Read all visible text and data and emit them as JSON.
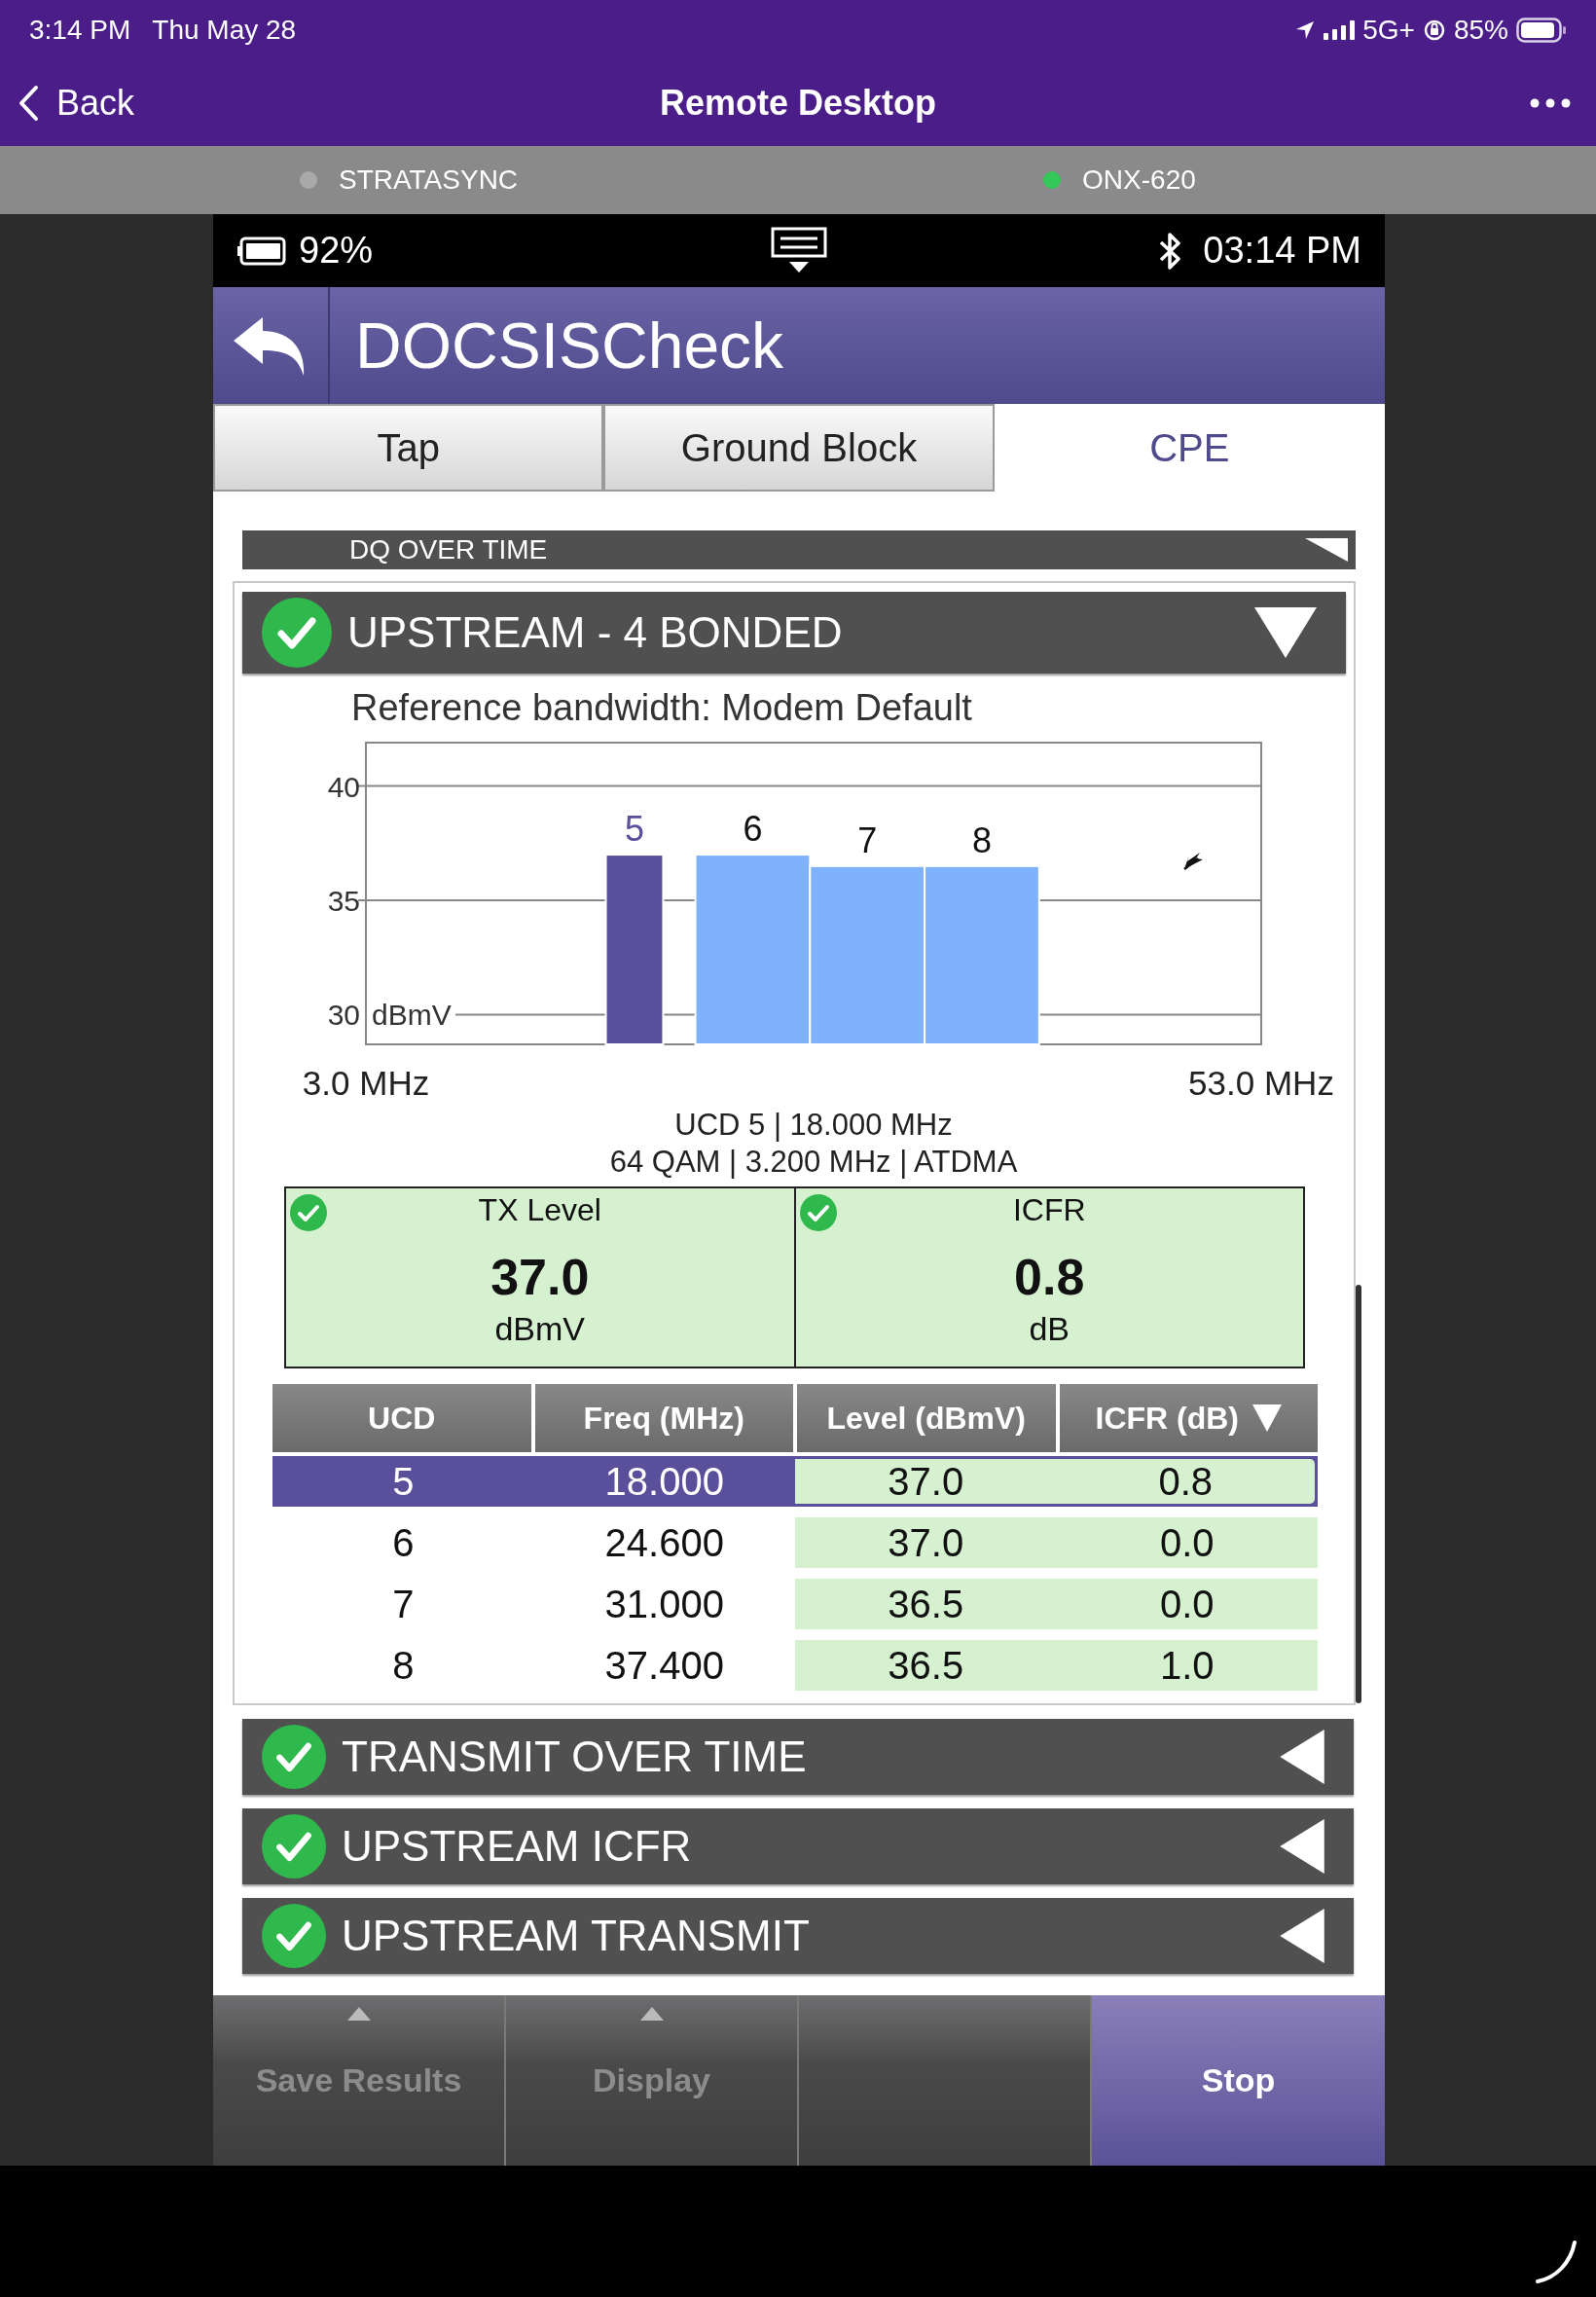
{
  "ios_status_bar": {
    "time": "3:14 PM",
    "date": "Thu May 28",
    "network": "5G+",
    "battery": "85%"
  },
  "nav_bar": {
    "back": "Back",
    "title": "Remote Desktop"
  },
  "connections": [
    {
      "name": "STRATASYNC",
      "color": "#a9a9a9"
    },
    {
      "name": "ONX-620",
      "color": "#34c759"
    }
  ],
  "device": {
    "status_bar": {
      "battery": "92%",
      "time": "03:14 PM"
    },
    "title": "DOCSISCheck",
    "tabs": [
      {
        "label": "Tap",
        "selected": false
      },
      {
        "label": "Ground Block",
        "selected": false
      },
      {
        "label": "CPE",
        "selected": true
      }
    ],
    "partial_section": {
      "title": "DQ OVER TIME"
    },
    "upstream": {
      "title": "UPSTREAM - 4 BONDED",
      "passed": true,
      "expanded": true,
      "reference": "Reference bandwidth: Modem Default",
      "chart_data": {
        "type": "bar",
        "x": [
          18.0,
          24.6,
          31.0,
          37.4
        ],
        "ylabel": "dBmV",
        "xlim": [
          3,
          53
        ],
        "ylim": [
          28.7,
          41.9
        ],
        "yticks": [
          30,
          35,
          40
        ],
        "xticks": [
          {
            "value": 3,
            "label": "3.0 MHz"
          },
          {
            "value": 53,
            "label": "53.0 MHz"
          }
        ],
        "grid": true,
        "value_labels": [
          "5",
          "6",
          "7",
          "8"
        ],
        "series": [
          {
            "color": "#5a4f9a",
            "values": [
              37.0,
              null,
              null,
              null
            ]
          },
          {
            "color": "#80b2fb",
            "values": [
              null,
              37.0,
              36.5,
              36.5
            ]
          }
        ]
      },
      "channel_info": [
        "UCD 5 | 18.000 MHz",
        "64 QAM | 3.200 MHz | ATDMA"
      ],
      "metrics": [
        {
          "label": "TX Level",
          "value": "37.0",
          "unit": "dBmV",
          "passed": true
        },
        {
          "label": "ICFR",
          "value": "0.8",
          "unit": "dB",
          "passed": true
        }
      ],
      "table": {
        "columns": [
          {
            "label": "UCD",
            "kind": "info",
            "sorted": false
          },
          {
            "label": "Freq (MHz)",
            "kind": "info",
            "sorted": false
          },
          {
            "label": "Level (dBmV)",
            "kind": "measure",
            "sorted": false
          },
          {
            "label": "ICFR (dB)",
            "kind": "measure",
            "sorted": true
          }
        ],
        "rows": [
          {
            "cells": [
              "5",
              "18.000",
              "37.0",
              "0.8"
            ],
            "selected": true
          },
          {
            "cells": [
              "6",
              "24.600",
              "37.0",
              "0.0"
            ],
            "selected": false
          },
          {
            "cells": [
              "7",
              "31.000",
              "36.5",
              "0.0"
            ],
            "selected": false
          },
          {
            "cells": [
              "8",
              "37.400",
              "36.5",
              "1.0"
            ],
            "selected": false
          }
        ]
      }
    },
    "sections": [
      {
        "title": "TRANSMIT OVER TIME",
        "passed": true,
        "expanded": false
      },
      {
        "title": "UPSTREAM ICFR",
        "passed": true,
        "expanded": false
      },
      {
        "title": "UPSTREAM TRANSMIT",
        "passed": true,
        "expanded": false
      }
    ],
    "buttons": [
      {
        "kind": "menu",
        "label": "Save Results",
        "disabled": true
      },
      {
        "kind": "menu",
        "label": "Display",
        "disabled": true
      },
      {
        "kind": "blank"
      },
      {
        "kind": "primary",
        "label": "Stop"
      }
    ]
  }
}
